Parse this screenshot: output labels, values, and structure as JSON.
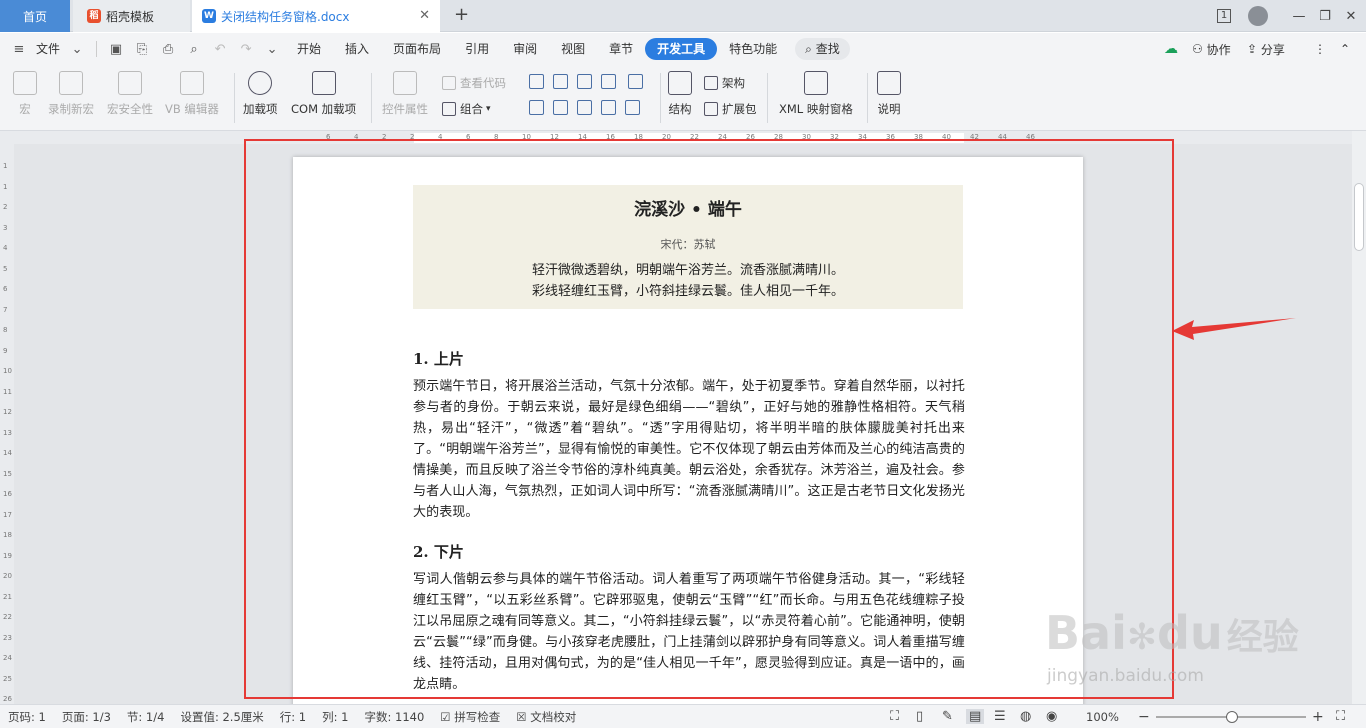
{
  "tabs": {
    "home": "首页",
    "daoke": "稻壳模板",
    "doc": "关闭结构任务窗格.docx",
    "close": "✕",
    "add": "+"
  },
  "window": {
    "page_badge": "1",
    "min": "—",
    "restore": "❐",
    "close": "✕"
  },
  "menubar": {
    "file": "文件",
    "items": [
      "开始",
      "插入",
      "页面布局",
      "引用",
      "审阅",
      "视图",
      "章节",
      "开发工具",
      "特色功能"
    ],
    "active": "开发工具",
    "search": "查找",
    "collab": "协作",
    "share": "分享",
    "more": "⋮",
    "collapse": "⌃"
  },
  "ribbon": {
    "macro": "宏",
    "record": "录制新宏",
    "security": "宏安全性",
    "vb": "VB 编辑器",
    "addin": "加载项",
    "com": "COM 加载项",
    "ctrlprop": "控件属性",
    "viewcode": "查看代码",
    "group": "组合",
    "struct": "结构",
    "arch": "架构",
    "expand": "扩展包",
    "xmlpane": "XML 映射窗格",
    "help": "说明"
  },
  "ruler_marks": [
    "6",
    "4",
    "2",
    "2",
    "4",
    "6",
    "8",
    "10",
    "12",
    "14",
    "16",
    "18",
    "20",
    "22",
    "24",
    "26",
    "28",
    "30",
    "32",
    "34",
    "36",
    "38",
    "40",
    "42",
    "44",
    "46"
  ],
  "vruler_marks": [
    "1",
    "1",
    "2",
    "3",
    "4",
    "5",
    "6",
    "7",
    "8",
    "9",
    "10",
    "11",
    "12",
    "13",
    "14",
    "15",
    "16",
    "17",
    "18",
    "19",
    "20",
    "21",
    "22",
    "23",
    "24",
    "25",
    "26"
  ],
  "document": {
    "poem_title": "浣溪沙 • 端午",
    "poem_author": "宋代：苏轼",
    "poem_line1": "轻汗微微透碧纨，明朝端午浴芳兰。流香涨腻满晴川。",
    "poem_line2": "彩线轻缠红玉臂，小符斜挂绿云鬟。佳人相见一千年。",
    "h1": "1.  上片",
    "p1": "预示端午节日，将开展浴兰活动，气氛十分浓郁。端午，处于初夏季节。穿着自然华丽，以衬托参与者的身份。于朝云来说，最好是绿色细绢——“碧纨”，正好与她的雅静性格相符。天气稍热，易出“轻汗”，“微透”着“碧纨”。“透”字用得贴切，将半明半暗的肤体朦胧美衬托出来了。“明朝端午浴芳兰”，显得有愉悦的审美性。它不仅体现了朝云由芳体而及兰心的纯洁高贵的情操美，而且反映了浴兰令节俗的淳朴纯真美。朝云浴处，余香犹存。沐芳浴兰，遍及社会。参与者人山人海，气氛热烈，正如词人词中所写：“流香涨腻满晴川”。这正是古老节日文化发扬光大的表现。",
    "h2": "2.  下片",
    "p2": "写词人偕朝云参与具体的端午节俗活动。词人着重写了两项端午节俗健身活动。其一，“彩线轻缠红玉臂”，“以五彩丝系臂”。它辟邪驱鬼，使朝云“玉臂”“红”而长命。与用五色花线缠粽子投江以吊屈原之魂有同等意义。其二，“小符斜挂绿云鬟”，以“赤灵符着心前”。它能通神明，使朝云“云鬟”“绿”而身健。与小孩穿老虎腰肚，门上挂蒲剑以辟邪护身有同等意义。词人着重描写缠线、挂符活动，且用对偶句式，为的是“佳人相见一千年”，愿灵验得到应证。真是一语中的，画龙点睛。"
  },
  "status": {
    "pagenum": "页码: 1",
    "pages": "页面: 1/3",
    "section": "节: 1/4",
    "setting": "设置值: 2.5厘米",
    "row": "行: 1",
    "col": "列: 1",
    "words": "字数: 1140",
    "spell": "拼写检查",
    "proof": "文档校对",
    "zoom": "100%",
    "minus": "−",
    "plus": "+"
  },
  "watermark": {
    "brand": "Bai",
    "brand2": "du",
    "jingyan": "经验",
    "url": "jingyan.baidu.com"
  },
  "colors": {
    "accent": "#2b7de0",
    "highlight_box": "#e53935",
    "poem_bg": "#f2f0e4"
  }
}
